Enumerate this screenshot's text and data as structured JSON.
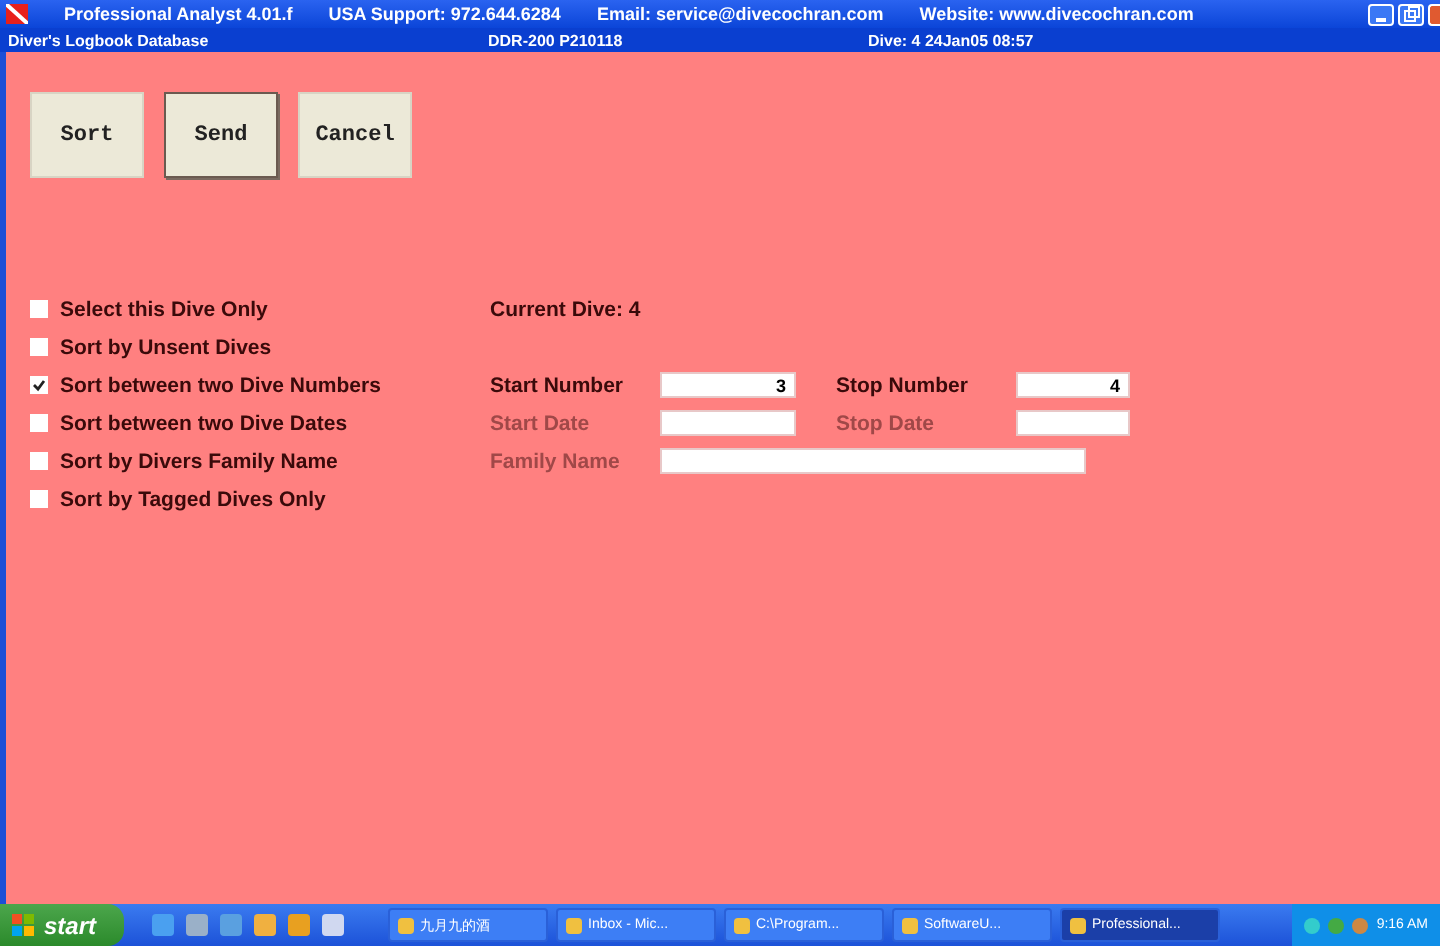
{
  "window": {
    "title": "Professional Analyst 4.01.f",
    "support": "USA Support: 972.644.6284",
    "email": "Email: service@divecochran.com",
    "website": "Website: www.divecochran.com"
  },
  "info_bar": {
    "section": "Diver's Logbook Database",
    "device": "DDR-200  P210118",
    "dive": "Dive: 4  24Jan05 08:57"
  },
  "buttons": [
    {
      "label": "Sort",
      "selected": false
    },
    {
      "label": "Send",
      "selected": true
    },
    {
      "label": "Cancel",
      "selected": false
    }
  ],
  "options": [
    {
      "label": "Select this Dive Only",
      "checked": false,
      "extras": [
        {
          "kind": "info",
          "text": "Current Dive: 4"
        }
      ]
    },
    {
      "label": "Sort by Unsent Dives",
      "checked": false
    },
    {
      "label": "Sort between two Dive Numbers",
      "checked": true,
      "extras": [
        {
          "kind": "label",
          "text": "Start Number",
          "disabled": false
        },
        {
          "kind": "field",
          "value": "3"
        },
        {
          "kind": "label",
          "text": "Stop Number",
          "disabled": false
        },
        {
          "kind": "field",
          "value": "4"
        }
      ]
    },
    {
      "label": "Sort between two Dive Dates",
      "checked": false,
      "extras": [
        {
          "kind": "label",
          "text": "Start Date",
          "disabled": true
        },
        {
          "kind": "field"
        },
        {
          "kind": "label",
          "text": "Stop Date",
          "disabled": true
        },
        {
          "kind": "field"
        }
      ]
    },
    {
      "label": "Sort by Divers Family Name",
      "checked": false,
      "extras": [
        {
          "kind": "label",
          "text": "Family Name",
          "disabled": true
        },
        {
          "kind": "wide_field"
        }
      ]
    },
    {
      "label": "Sort by Tagged Dives Only",
      "checked": false
    }
  ],
  "taskbar": {
    "start": "start",
    "tasks": [
      {
        "label": "九月九的酒",
        "selected": false
      },
      {
        "label": "Inbox - Mic...",
        "selected": false
      },
      {
        "label": "C:\\Program...",
        "selected": false
      },
      {
        "label": "SoftwareU...",
        "selected": false
      },
      {
        "label": "Professional...",
        "selected": true
      }
    ],
    "clock": "9:16 AM"
  }
}
